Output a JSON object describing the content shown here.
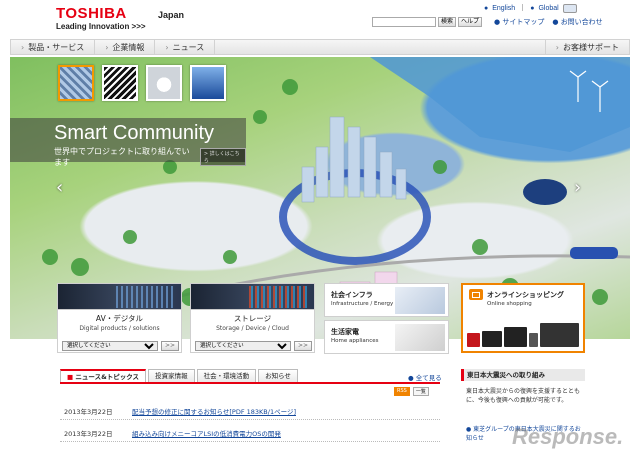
{
  "header": {
    "brand": "TOSHIBA",
    "tagline": "Leading Innovation >>>",
    "region": "Japan",
    "lang_english": "English",
    "lang_global": "Global",
    "search_placeholder": "",
    "search_button": "検索",
    "help_button": "ヘルプ",
    "sitemap": "サイトマップ",
    "contact": "お問い合わせ"
  },
  "nav": {
    "items": [
      "製品・サービス",
      "企業情報",
      "ニュース"
    ],
    "support": "お客様サポート"
  },
  "hero": {
    "title": "Smart Community",
    "subtitle": "世界中でプロジェクトに取り組んでいます",
    "more": "> 詳しくはこちら"
  },
  "categories": {
    "av": {
      "name": "AV・デジタル",
      "en": "Digital products / solutions",
      "select": "選択してください"
    },
    "storage": {
      "name": "ストレージ",
      "en": "Storage / Device / Cloud",
      "select": "選択してください"
    },
    "infra": {
      "name": "社会インフラ",
      "en": "Infrastructure / Energy"
    },
    "home": {
      "name": "生活家電",
      "en": "Home appliances"
    },
    "shop": {
      "name": "オンラインショッピング",
      "en": "Online shopping"
    },
    "go": ">>"
  },
  "news": {
    "tabs": [
      "ニュース&トピックス",
      "投資家情報",
      "社会・環境活動",
      "お知らせ"
    ],
    "all": "全て見る",
    "rss": "RSS",
    "list": "一覧",
    "items": [
      {
        "date": "2013年3月22日",
        "title": "配当予想の修正に関するお知らせ[PDF 183KB/1ページ]"
      },
      {
        "date": "2013年3月22日",
        "title": "組み込み向けメニーコアLSIの低消費電力OSの開発"
      }
    ]
  },
  "side": {
    "title": "東日本大震災への取り組み",
    "body": "東日本大震災からの復興を支援するとともに、今後も復興への貢献が可能です。",
    "link": "東芝グループの東日本大震災に関するお知らせ"
  },
  "watermark": "Response."
}
